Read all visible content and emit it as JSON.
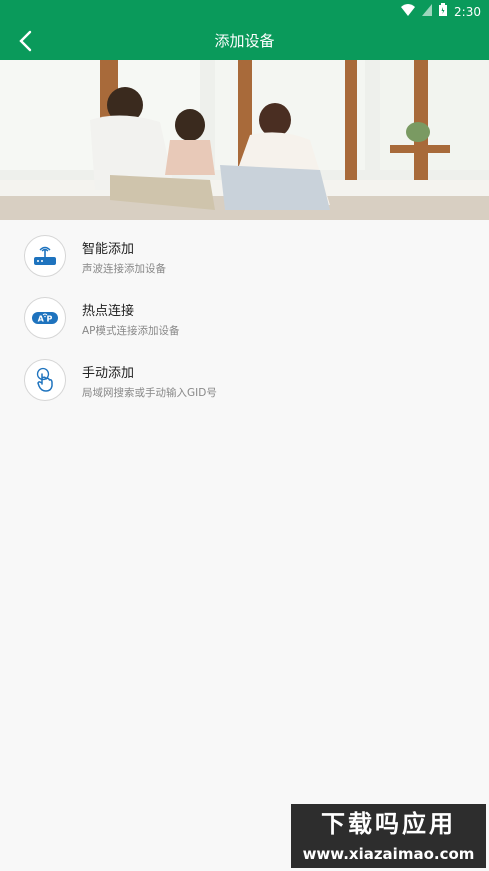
{
  "status_bar": {
    "time": "2:30"
  },
  "header": {
    "title": "添加设备"
  },
  "options": [
    {
      "name": "智能添加",
      "desc": "声波连接添加设备",
      "icon": "router-icon"
    },
    {
      "name": "热点连接",
      "desc": "AP模式连接添加设备",
      "icon": "ap-icon"
    },
    {
      "name": "手动添加",
      "desc": "局域网搜索或手动输入GID号",
      "icon": "hand-touch-icon"
    }
  ],
  "watermark": {
    "line1": "下载吗应用",
    "line2": "www.xiazaimao.com"
  },
  "colors": {
    "primary": "#0a9a5b",
    "accent": "#1e73be"
  }
}
